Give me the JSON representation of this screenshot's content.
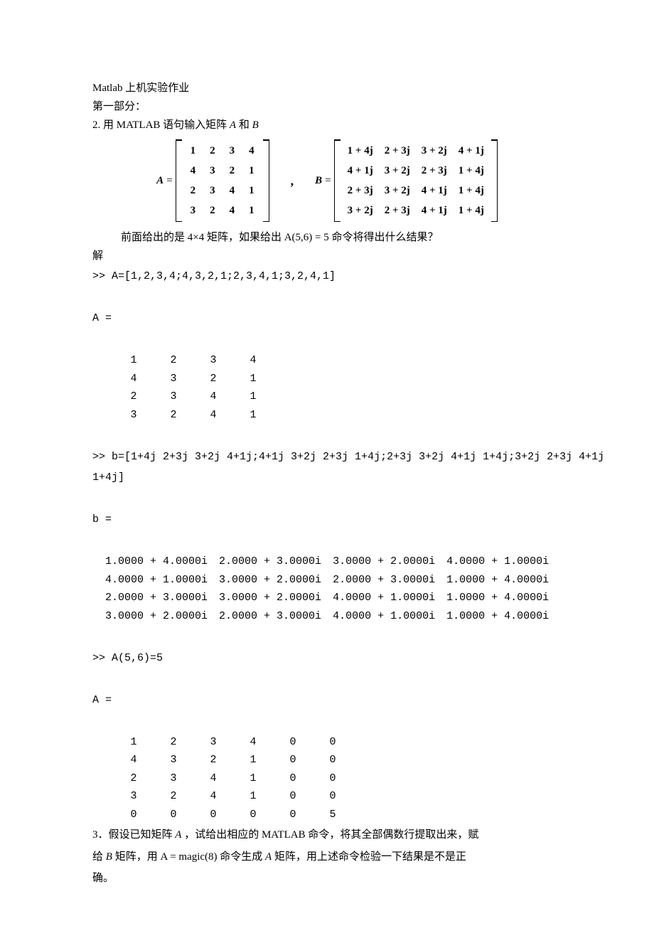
{
  "title": "Matlab 上机实验作业",
  "section1": "第一部分：",
  "q2_intro_pre": "2. 用 MATLAB 语句输入矩阵 ",
  "q2_intro_mid": " 和 ",
  "matrix_A_label": "A",
  "matrix_B_label": "B",
  "matrix_A": [
    [
      "1",
      "2",
      "3",
      "4"
    ],
    [
      "4",
      "3",
      "2",
      "1"
    ],
    [
      "2",
      "3",
      "4",
      "1"
    ],
    [
      "3",
      "2",
      "4",
      "1"
    ]
  ],
  "matrix_B": [
    [
      "1 + 4j",
      "2 + 3j",
      "3 + 2j",
      "4 + 1j"
    ],
    [
      "4 + 1j",
      "3 + 2j",
      "2 + 3j",
      "1 + 4j"
    ],
    [
      "2 + 3j",
      "3 + 2j",
      "4 + 1j",
      "1 + 4j"
    ],
    [
      "3 + 2j",
      "2 + 3j",
      "4 + 1j",
      "1 + 4j"
    ]
  ],
  "matrix_sep": ",",
  "q2_note": "前面给出的是 4×4 矩阵，如果给出 A(5,6) = 5 命令将得出什么结果？",
  "solution_label": "解",
  "cmd_A": ">> A=[1,2,3,4;4,3,2,1;2,3,4,1;3,2,4,1]",
  "out_A_label": "A =",
  "out_A_matrix": [
    [
      "1",
      "2",
      "3",
      "4"
    ],
    [
      "4",
      "3",
      "2",
      "1"
    ],
    [
      "2",
      "3",
      "4",
      "1"
    ],
    [
      "3",
      "2",
      "4",
      "1"
    ]
  ],
  "cmd_b_line1": ">> b=[1+4j 2+3j 3+2j 4+1j;4+1j 3+2j 2+3j 1+4j;2+3j 3+2j 4+1j 1+4j;3+2j 2+3j 4+1j",
  "cmd_b_line2": "1+4j]",
  "out_b_label": "b =",
  "out_b_matrix": [
    [
      "1.0000 + 4.0000i",
      "2.0000 + 3.0000i",
      "3.0000 + 2.0000i",
      "4.0000 + 1.0000i"
    ],
    [
      "4.0000 + 1.0000i",
      "3.0000 + 2.0000i",
      "2.0000 + 3.0000i",
      "1.0000 + 4.0000i"
    ],
    [
      "2.0000 + 3.0000i",
      "3.0000 + 2.0000i",
      "4.0000 + 1.0000i",
      "1.0000 + 4.0000i"
    ],
    [
      "3.0000 + 2.0000i",
      "2.0000 + 3.0000i",
      "4.0000 + 1.0000i",
      "1.0000 + 4.0000i"
    ]
  ],
  "cmd_A56": ">> A(5,6)=5",
  "out_A2_label": "A =",
  "out_A2_matrix": [
    [
      "1",
      "2",
      "3",
      "4",
      "0",
      "0"
    ],
    [
      "4",
      "3",
      "2",
      "1",
      "0",
      "0"
    ],
    [
      "2",
      "3",
      "4",
      "1",
      "0",
      "0"
    ],
    [
      "3",
      "2",
      "4",
      "1",
      "0",
      "0"
    ],
    [
      "0",
      "0",
      "0",
      "0",
      "0",
      "5"
    ]
  ],
  "q3_line1_pre": "3．假设已知矩阵 ",
  "q3_line1_mid1": " ，试给出相应的 MATLAB 命令，将其全部偶数行提取出来，赋",
  "q3_line2_pre": "给 ",
  "q3_line2_mid": " 矩阵，用 A = magic(8) 命令生成 ",
  "q3_line2_post": " 矩阵，用上述命令检验一下结果是不是正",
  "q3_line3": "确。",
  "italic_A": "A",
  "italic_B": "B"
}
